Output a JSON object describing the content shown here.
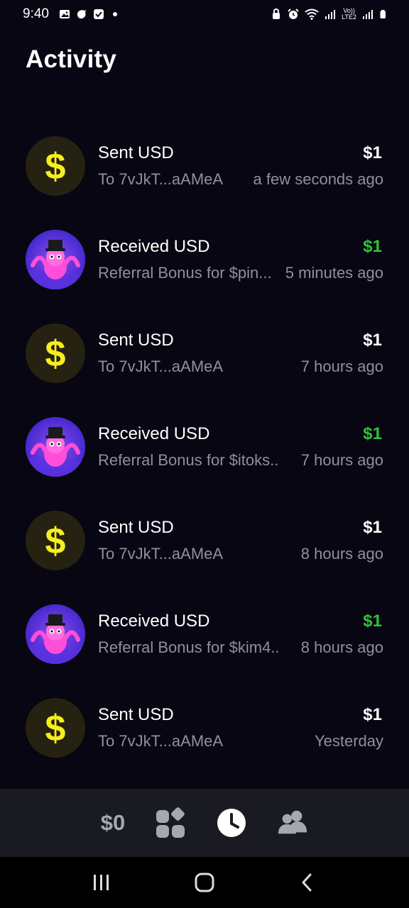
{
  "status_bar": {
    "time": "9:40",
    "network_label": "Vo))\nLTE2"
  },
  "page": {
    "title": "Activity"
  },
  "colors": {
    "background": "#070612",
    "received_amount": "#2fc23a",
    "sent_amount": "#ffffff",
    "secondary_text": "#8f8fa0",
    "dollar_icon": "#f7ee1e"
  },
  "activity": [
    {
      "type": "sent",
      "title": "Sent USD",
      "amount": "$1",
      "subtitle": "To 7vJkT...aAMeA",
      "time": "a few seconds ago",
      "icon": "dollar-icon"
    },
    {
      "type": "received",
      "title": "Received USD",
      "amount": "$1",
      "subtitle": "Referral Bonus for $pin...",
      "time": "5 minutes ago",
      "icon": "profile-avatar"
    },
    {
      "type": "sent",
      "title": "Sent USD",
      "amount": "$1",
      "subtitle": "To 7vJkT...aAMeA",
      "time": "7 hours ago",
      "icon": "dollar-icon"
    },
    {
      "type": "received",
      "title": "Received USD",
      "amount": "$1",
      "subtitle": "Referral Bonus for $itoks...",
      "time": "7 hours ago",
      "icon": "profile-avatar"
    },
    {
      "type": "sent",
      "title": "Sent USD",
      "amount": "$1",
      "subtitle": "To 7vJkT...aAMeA",
      "time": "8 hours ago",
      "icon": "dollar-icon"
    },
    {
      "type": "received",
      "title": "Received USD",
      "amount": "$1",
      "subtitle": "Referral Bonus for $kim4...",
      "time": "8 hours ago",
      "icon": "profile-avatar"
    },
    {
      "type": "sent",
      "title": "Sent USD",
      "amount": "$1",
      "subtitle": "To 7vJkT...aAMeA",
      "time": "Yesterday",
      "icon": "dollar-icon"
    }
  ],
  "bottom_nav": {
    "balance_label": "$0",
    "items": [
      "balance",
      "apps-icon",
      "clock-icon",
      "people-icon"
    ]
  }
}
